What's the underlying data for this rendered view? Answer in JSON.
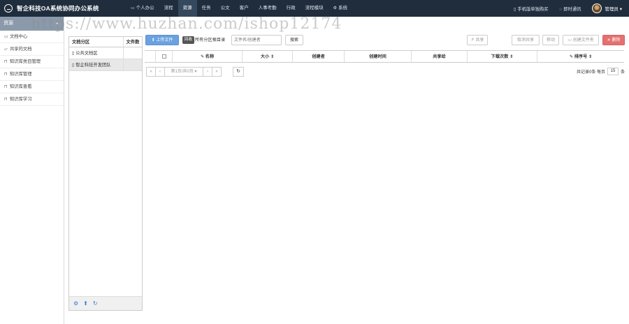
{
  "app": {
    "title": "智企科技OA系统协同办公系统"
  },
  "nav": {
    "items": [
      {
        "label": "个人办公",
        "icon": "monitor-icon"
      },
      {
        "label": "流程"
      },
      {
        "label": "资源"
      },
      {
        "label": "任务"
      },
      {
        "label": "公文"
      },
      {
        "label": "客户"
      },
      {
        "label": "人事考勤"
      },
      {
        "label": "行政"
      },
      {
        "label": "流程模块"
      },
      {
        "label": "系统",
        "icon": "gear-icon"
      }
    ],
    "active": "资源"
  },
  "topright": {
    "mobile": "手机版单独购买",
    "im": "即时通讯",
    "user": "管理员"
  },
  "sidebar": {
    "header": "资源",
    "items": [
      {
        "label": "文档中心",
        "icon": "folder-icon"
      },
      {
        "label": "共享的文档",
        "icon": "folder-open-icon"
      },
      {
        "label": "知识库类目管理",
        "icon": "bookmark-icon"
      },
      {
        "label": "知识库管理",
        "icon": "bookmark-icon"
      },
      {
        "label": "知识库查看",
        "icon": "bookmark-icon"
      },
      {
        "label": "知识库学习",
        "icon": "bookmark-icon"
      }
    ]
  },
  "tree": {
    "col_partition": "文档分区",
    "col_count": "文件数",
    "rows": [
      {
        "label": "公共文档区"
      },
      {
        "label": "智企科技开发团队"
      }
    ]
  },
  "toolbar": {
    "upload": "上传文件",
    "tag": "回收",
    "tag_text": "所有分区根目录",
    "search_placeholder": "文件名/创建者",
    "search_btn": "搜索",
    "share": "共享",
    "unshare": "取消共享",
    "move": "移动",
    "new_folder": "创建文件夹",
    "delete": "删除"
  },
  "grid": {
    "columns": [
      "名称",
      "大小",
      "创建者",
      "创建时间",
      "共享给",
      "下载次数",
      "排序号"
    ]
  },
  "pager": {
    "first": "«",
    "prev": "‹",
    "page": "第1页/共0页",
    "next": "›",
    "last": "»",
    "total": "共记录0条",
    "per_page_label": "每页",
    "per_page": "15",
    "unit": "条"
  },
  "watermark": "https://www.huzhan.com/ishop12174"
}
